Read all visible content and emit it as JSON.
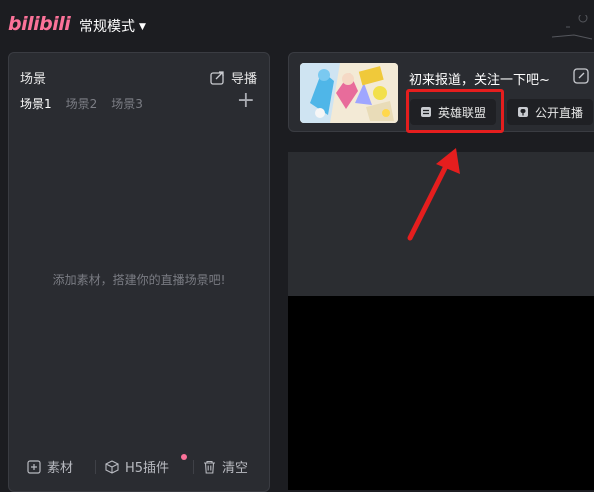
{
  "app": {
    "logo": "bilibili",
    "mode_label": "常规模式"
  },
  "scene_panel": {
    "title": "场景",
    "director_label": "导播",
    "tabs": [
      {
        "label": "场景1",
        "active": true
      },
      {
        "label": "场景2",
        "active": false
      },
      {
        "label": "场景3",
        "active": false
      }
    ],
    "empty_hint": "添加素材，搭建你的直播场景吧!",
    "bottom": {
      "material_label": "素材",
      "h5_label": "H5插件",
      "clear_label": "清空"
    }
  },
  "live_card": {
    "title": "初来报道，关注一下吧~",
    "category_label": "英雄联盟",
    "visibility_label": "公开直播"
  },
  "colors": {
    "brand": "#fb7299",
    "annotation": "#e51e1e",
    "panel": "#2a2c31"
  }
}
